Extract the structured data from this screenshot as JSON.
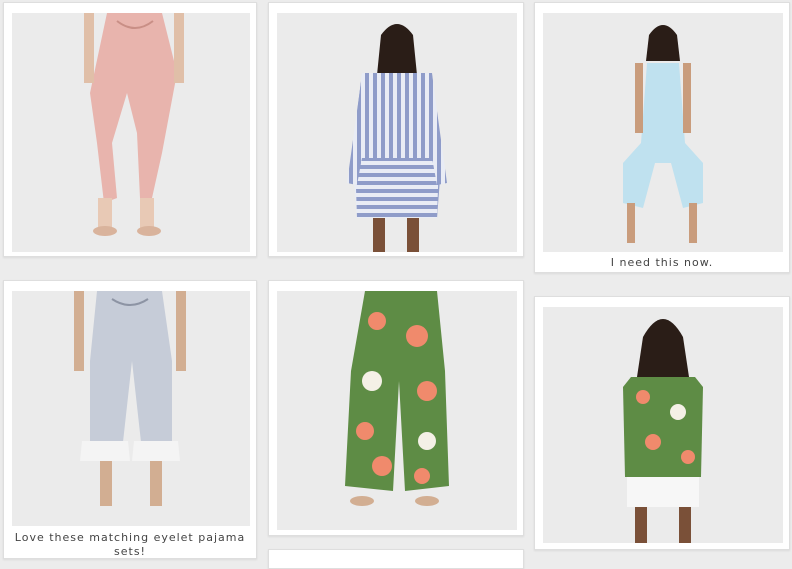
{
  "pins": [
    {
      "name": "pink-jogger-pants",
      "caption": "",
      "outfit": "#e8b4ad"
    },
    {
      "name": "striped-sleep-shirt",
      "caption": "",
      "outfit": "#9aa7cf"
    },
    {
      "name": "blue-romper",
      "caption": "I need this now.",
      "outfit": "#bfe1ef"
    },
    {
      "name": "eyelet-pajama-pants",
      "caption": "Love these matching eyelet pajama sets!",
      "outfit": "#c6ccd8"
    },
    {
      "name": "floral-wide-pants",
      "caption": "",
      "outfit": "#5e8c45"
    },
    {
      "name": "floral-ruffle-top",
      "caption": "",
      "outfit": "#5e8c45"
    }
  ]
}
